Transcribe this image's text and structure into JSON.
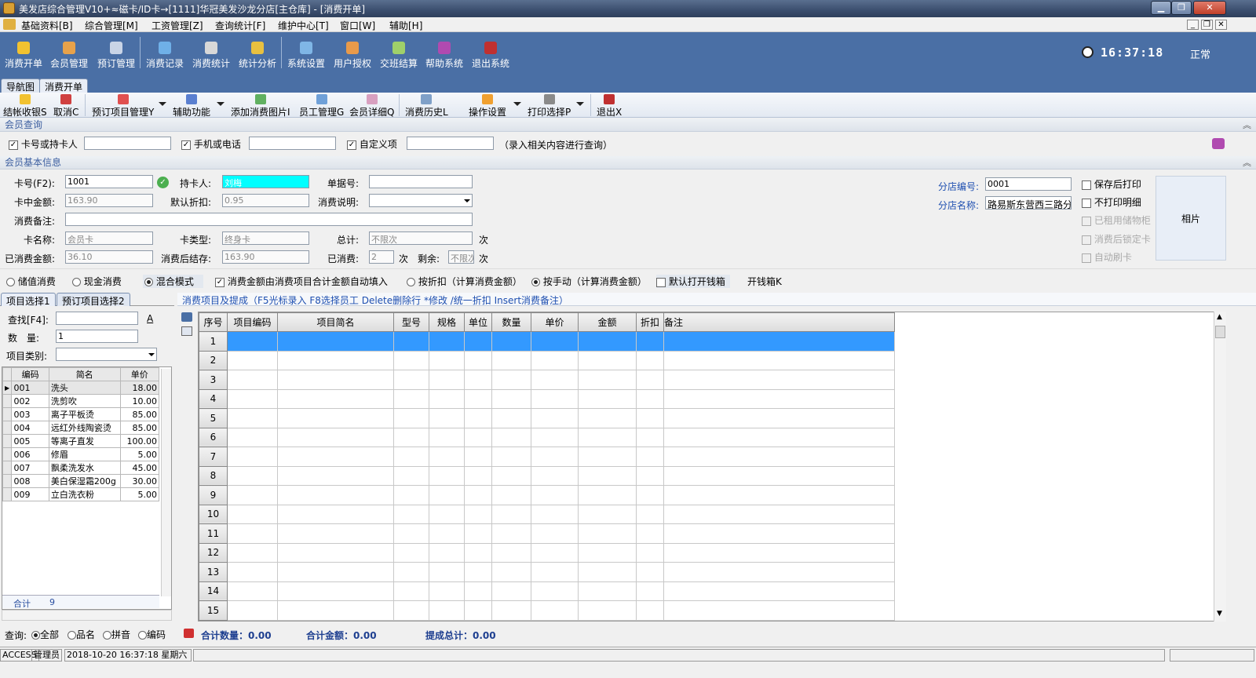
{
  "window": {
    "title": "美发店综合管理V10+≈磁卡/ID卡→[1111]华冠美发沙龙分店[主仓库] - [消费开单]"
  },
  "menu": [
    "基础资料[B]",
    "综合管理[M]",
    "工资管理[Z]",
    "查询统计[F]",
    "维护中心[T]",
    "窗口[W]",
    "辅助[H]"
  ],
  "main_toolbar": [
    "消费开单",
    "会员管理",
    "预订管理",
    "消费记录",
    "消费统计",
    "统计分析",
    "系统设置",
    "用户授权",
    "交班结算",
    "帮助系统",
    "退出系统"
  ],
  "clock": "16:37:18",
  "status_mode": "正常",
  "tabs": [
    "导航图",
    "消费开单"
  ],
  "sub_toolbar": [
    "结帐收银S",
    "取消C",
    "预订项目管理Y",
    "辅助功能",
    "添加消费图片I",
    "员工管理G",
    "会员详细Q",
    "消费历史L",
    "操作设置",
    "打印选择P",
    "退出X"
  ],
  "member_query": {
    "header": "会员查询",
    "card_label": "卡号或持卡人",
    "phone_label": "手机或电话",
    "custom_label": "自定义项",
    "hint": "（录入相关内容进行查询）"
  },
  "member_info": {
    "header": "会员基本信息",
    "card_no_label": "卡号(F2):",
    "card_no": "1001",
    "holder_label": "持卡人:",
    "holder": "刘梅",
    "bill_label": "单据号:",
    "bill": "",
    "balance_label": "卡中金额:",
    "balance": "163.90",
    "discount_label": "默认折扣:",
    "discount": "0.95",
    "desc_label": "消费说明:",
    "desc": "",
    "remark_label": "消费备注:",
    "remark": "",
    "card_name_label": "卡名称:",
    "card_name": "会员卡",
    "card_type_label": "卡类型:",
    "card_type": "终身卡",
    "total_label": "总计:",
    "total": "不限次",
    "unit_times": "次",
    "spent_label": "已消费金额:",
    "spent": "36.10",
    "after_balance_label": "消费后结存:",
    "after_balance": "163.90",
    "used_label": "已消费:",
    "used": "2",
    "remain_label": "剩余:",
    "remain": "不限次",
    "branch_no_label": "分店编号:",
    "branch_no": "0001",
    "branch_name_label": "分店名称:",
    "branch_name": "路易斯东营西三路分",
    "opt_save_print": "保存后打印",
    "opt_no_detail": "不打印明细",
    "opt_used_cabinet": "已租用储物柜",
    "opt_lock_card": "消费后锁定卡",
    "opt_auto_swipe": "自动刷卡",
    "photo_label": "相片"
  },
  "modes": {
    "stored": "储值消费",
    "cash": "现金消费",
    "mixed": "混合模式",
    "auto_fill": "消费金额由消费项目合计金额自动填入",
    "by_discount": "按折扣（计算消费金额）",
    "by_manual": "按手动（计算消费金额）",
    "open_drawer": "默认打开钱箱",
    "drawer_btn": "开钱箱K"
  },
  "left_tabs": [
    "项目选择1",
    "预订项目选择2"
  ],
  "left_form": {
    "find_label": "查找[F4]:",
    "find": "",
    "find_btn": "A",
    "qty_label": "数　量:",
    "qty": "1",
    "cat_label": "项目类别:"
  },
  "item_headers": [
    "编码",
    "简名",
    "单价"
  ],
  "items": [
    [
      "001",
      "洗头",
      "18.00"
    ],
    [
      "002",
      "洗剪吹",
      "10.00"
    ],
    [
      "003",
      "离子平板烫",
      "85.00"
    ],
    [
      "004",
      "远红外线陶瓷烫",
      "85.00"
    ],
    [
      "005",
      "等离子直发",
      "100.00"
    ],
    [
      "006",
      "修眉",
      "5.00"
    ],
    [
      "007",
      "飘柔洗发水",
      "45.00"
    ],
    [
      "008",
      "美白保湿霜200g",
      "30.00"
    ],
    [
      "009",
      "立白洗衣粉",
      "5.00"
    ]
  ],
  "item_total_label": "合计",
  "item_total": "9",
  "query_mode": {
    "label": "查询:",
    "all": "全部",
    "name": "品名",
    "pinyin": "拼音",
    "code": "编码"
  },
  "consume_caption": "消费项目及提成（F5光标录入 F8选择员工 Delete删除行 *修改 /统一折扣 Insert消费备注）",
  "grid_headers": [
    "序号",
    "项目编码",
    "项目简名",
    "型号",
    "规格",
    "单位",
    "数量",
    "单价",
    "金额",
    "折扣",
    "备注"
  ],
  "grid_rows": [
    "1",
    "2",
    "3",
    "4",
    "5",
    "6",
    "7",
    "8",
    "9",
    "10",
    "11",
    "12",
    "13",
    "14",
    "15"
  ],
  "summary": {
    "qty": "合计数量：0.00",
    "amount": "合计金额：0.00",
    "commission": "提成总计：0.00"
  },
  "statusbar": {
    "db": "ACCESS",
    "user": "管理员",
    "datetime": "2018-10-20 16:37:18 星期六"
  },
  "colors": {
    "toolbar": "#4a6fa5",
    "highlight": "#3399ff",
    "section_text": "#3d5fa0"
  }
}
